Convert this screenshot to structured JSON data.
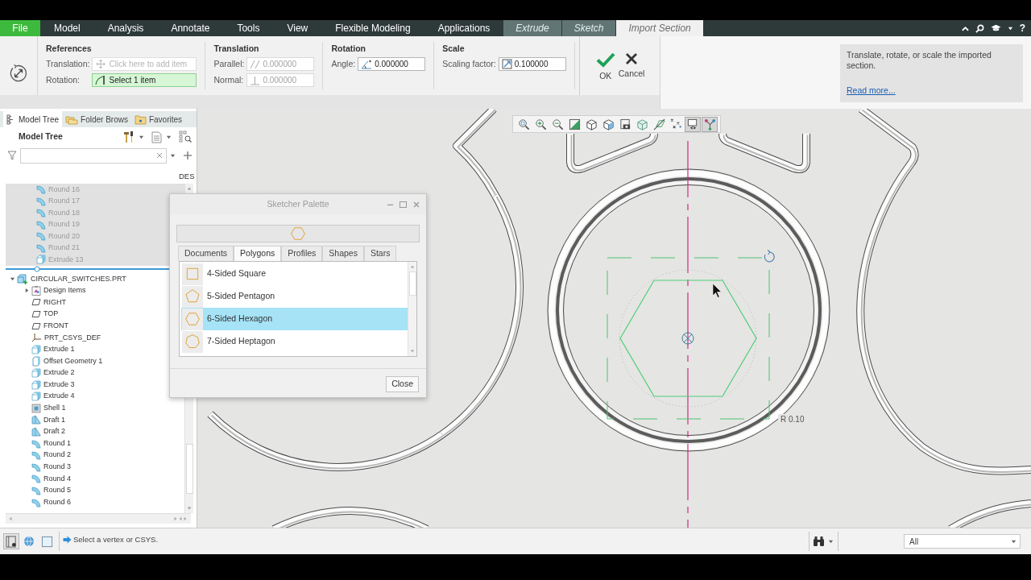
{
  "menu_bar": {
    "tabs": [
      {
        "label": "File",
        "kind": "file",
        "selected": false
      },
      {
        "label": "Model",
        "kind": "main",
        "selected": false
      },
      {
        "label": "Analysis",
        "kind": "main",
        "selected": false
      },
      {
        "label": "Annotate",
        "kind": "main",
        "selected": false
      },
      {
        "label": "Tools",
        "kind": "main",
        "selected": false
      },
      {
        "label": "View",
        "kind": "main",
        "selected": false
      },
      {
        "label": "Flexible Modeling",
        "kind": "main",
        "selected": false
      },
      {
        "label": "Applications",
        "kind": "main",
        "selected": false
      },
      {
        "label": "Extrude",
        "kind": "context",
        "selected": false
      },
      {
        "label": "Sketch",
        "kind": "context",
        "selected": false
      },
      {
        "label": "Import Section",
        "kind": "context",
        "selected": true
      }
    ],
    "help": "?"
  },
  "ribbon": {
    "groups": [
      {
        "title": "References",
        "fields": [
          {
            "label": "Translation:",
            "kind": "translation_ref",
            "placeholder": "Click here to add item",
            "active": false
          },
          {
            "label": "Rotation:",
            "kind": "rotation_ref",
            "value": "Select 1 item",
            "active": true
          }
        ]
      },
      {
        "title": "Translation",
        "fields": [
          {
            "label": "Parallel:",
            "kind": "parallel",
            "value": "0.000000",
            "disabled": true
          },
          {
            "label": "Normal:",
            "kind": "normal",
            "value": "0.000000",
            "disabled": true
          }
        ]
      },
      {
        "title": "Rotation",
        "fields": [
          {
            "label": "Angle:",
            "kind": "angle",
            "value": "0.000000",
            "disabled": false
          }
        ]
      },
      {
        "title": "Scale",
        "fields": [
          {
            "label": "Scaling factor:",
            "kind": "scale",
            "value": "0.100000",
            "disabled": false
          }
        ]
      }
    ],
    "actions": [
      {
        "label": "OK",
        "kind": "ok"
      },
      {
        "label": "Cancel",
        "kind": "cancel"
      }
    ],
    "info": {
      "text": "Translate, rotate, or scale the imported section.",
      "link": "Read more..."
    }
  },
  "left_panel": {
    "tabs": [
      {
        "label": "Model Tree",
        "kind": "tree",
        "selected": true
      },
      {
        "label": "Folder Brows",
        "kind": "folder",
        "selected": false
      },
      {
        "label": "Favorites",
        "kind": "favorites",
        "selected": false
      }
    ],
    "title": "Model Tree",
    "column": "DES",
    "upper_items": [
      {
        "label": "Round 16",
        "kind": "round",
        "disabled": true
      },
      {
        "label": "Round 17",
        "kind": "round",
        "disabled": true
      },
      {
        "label": "Round 18",
        "kind": "round",
        "disabled": true
      },
      {
        "label": "Round 19",
        "kind": "round",
        "disabled": true
      },
      {
        "label": "Round 20",
        "kind": "round",
        "disabled": true
      },
      {
        "label": "Round 21",
        "kind": "round",
        "disabled": true
      },
      {
        "label": "Extrude 13",
        "kind": "extrude",
        "disabled": true
      }
    ],
    "tree": [
      {
        "label": "CIRCULAR_SWITCHES.PRT",
        "kind": "part",
        "expanded": true,
        "children": [
          {
            "label": "Design Items",
            "kind": "design_items",
            "expanded": false
          },
          {
            "label": "RIGHT",
            "kind": "plane"
          },
          {
            "label": "TOP",
            "kind": "plane"
          },
          {
            "label": "FRONT",
            "kind": "plane"
          },
          {
            "label": "PRT_CSYS_DEF",
            "kind": "csys"
          },
          {
            "label": "Extrude 1",
            "kind": "extrude"
          },
          {
            "label": "Offset Geometry 1",
            "kind": "offset"
          },
          {
            "label": "Extrude 2",
            "kind": "extrude"
          },
          {
            "label": "Extrude 3",
            "kind": "extrude"
          },
          {
            "label": "Extrude 4",
            "kind": "extrude"
          },
          {
            "label": "Shell 1",
            "kind": "shell"
          },
          {
            "label": "Draft 1",
            "kind": "draft"
          },
          {
            "label": "Draft 2",
            "kind": "draft"
          },
          {
            "label": "Round 1",
            "kind": "round"
          },
          {
            "label": "Round 2",
            "kind": "round"
          },
          {
            "label": "Round 3",
            "kind": "round"
          },
          {
            "label": "Round 4",
            "kind": "round"
          },
          {
            "label": "Round 5",
            "kind": "round"
          },
          {
            "label": "Round 6",
            "kind": "round"
          }
        ]
      }
    ]
  },
  "palette": {
    "title": "Sketcher Palette",
    "tabs": [
      {
        "label": "Documents",
        "selected": false
      },
      {
        "label": "Polygons",
        "selected": true
      },
      {
        "label": "Profiles",
        "selected": false
      },
      {
        "label": "Shapes",
        "selected": false
      },
      {
        "label": "Stars",
        "selected": false
      }
    ],
    "items": [
      {
        "label": "4-Sided Square",
        "kind": "square",
        "selected": false
      },
      {
        "label": "5-Sided Pentagon",
        "kind": "pentagon",
        "selected": false
      },
      {
        "label": "6-Sided Hexagon",
        "kind": "hexagon",
        "selected": true
      },
      {
        "label": "7-Sided Heptagon",
        "kind": "heptagon",
        "selected": false
      }
    ],
    "close": "Close"
  },
  "viewport": {
    "toolbar": [
      {
        "kind": "refit",
        "selected": false
      },
      {
        "kind": "zoom_in",
        "selected": false
      },
      {
        "kind": "zoom_out",
        "selected": false
      },
      {
        "kind": "repaint",
        "selected": false
      },
      {
        "kind": "display_style",
        "selected": false
      },
      {
        "kind": "saved_views",
        "selected": false
      },
      {
        "kind": "view_manager",
        "selected": false
      },
      {
        "kind": "perspective",
        "selected": false
      },
      {
        "kind": "plane_display",
        "selected": false
      },
      {
        "kind": "point_display",
        "selected": false
      },
      {
        "kind": "sketch_display",
        "selected": true
      },
      {
        "kind": "spin_center",
        "selected": true
      }
    ],
    "dimension": "R 0.10"
  },
  "status_bar": {
    "message": "Select a vertex or CSYS.",
    "filter": "All"
  }
}
